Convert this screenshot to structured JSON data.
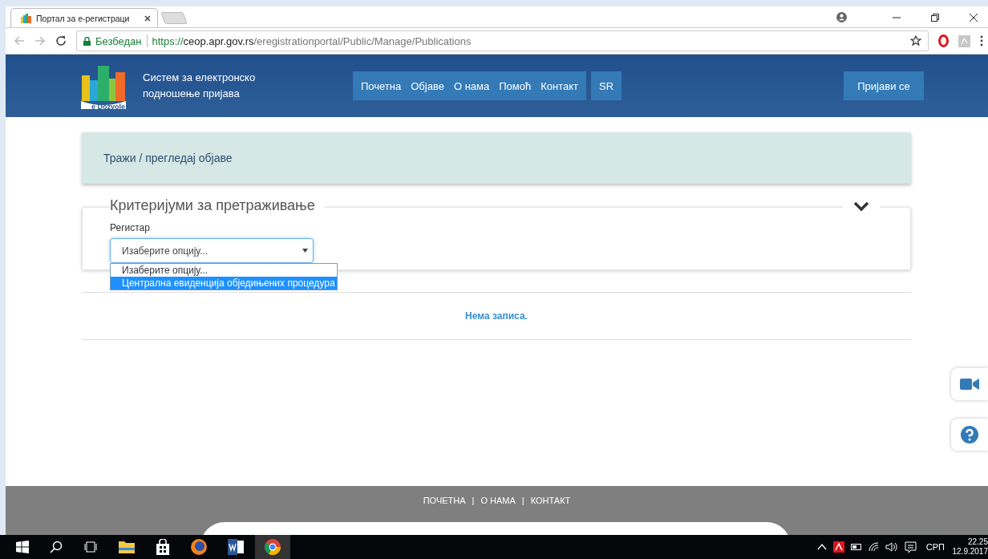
{
  "browser": {
    "tab_title": "Портал за е-регистраци",
    "secure_label": "Безбедан",
    "url_scheme": "https://",
    "url_host": "ceop.apr.gov.rs",
    "url_path": "/eregistrationportal/Public/Manage/Publications"
  },
  "header": {
    "logo_text": "e Dozvole",
    "site_title": [
      "Систем за електронско",
      "подношење пријава"
    ],
    "nav": [
      {
        "label": "Почетна"
      },
      {
        "label": "Објаве"
      },
      {
        "label": "О нама"
      },
      {
        "label": "Помоћ"
      },
      {
        "label": "Контакт"
      }
    ],
    "language": "SR",
    "login": "Пријави се"
  },
  "breadcrumb": "Тражи / прегледај објаве",
  "criteria": {
    "legend": "Критеријуми за претраживање",
    "expanded": true,
    "field_label": "Регистар",
    "select_value": "Изаберите опцију...",
    "options": [
      {
        "label": "Изаберите опцију...",
        "selected": false
      },
      {
        "label": "Централна евиденција обједињених процедура",
        "selected": true
      }
    ]
  },
  "empty_message": "Нема записа.",
  "footer": {
    "links": [
      "ПОЧЕТНА",
      "О НАМА",
      "КОНТАКТ"
    ],
    "separator": "|"
  },
  "taskbar": {
    "language": "СРП",
    "time": "22.25",
    "date": "12.9.2017"
  }
}
